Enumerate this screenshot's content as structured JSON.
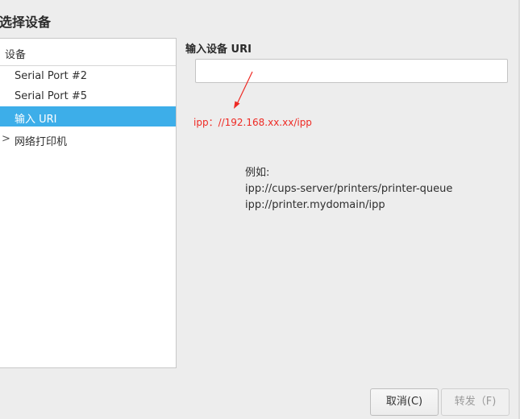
{
  "window": {
    "title": "选择设备"
  },
  "device_list": {
    "header": "设备",
    "items": [
      {
        "label": "Serial Port #2",
        "selected": false,
        "expandable": false
      },
      {
        "label": "Serial Port #5",
        "selected": false,
        "expandable": false
      },
      {
        "label": "输入 URI",
        "selected": true,
        "expandable": false
      },
      {
        "label": "网络打印机",
        "selected": false,
        "expandable": true
      }
    ],
    "expander_glyph": ">"
  },
  "uri_section": {
    "label": "输入设备 URI",
    "value": "",
    "placeholder": ""
  },
  "annotation": {
    "text": "ipp：//192.168.xx.xx/ipp",
    "color": "#ee2a24"
  },
  "example": {
    "heading": "例如:",
    "lines": [
      "ipp://cups-server/printers/printer-queue",
      "ipp://printer.mydomain/ipp"
    ]
  },
  "buttons": {
    "cancel": "取消(C)",
    "forward": "转发（F)"
  },
  "colors": {
    "selection": "#3daee9",
    "background": "#ededed"
  }
}
